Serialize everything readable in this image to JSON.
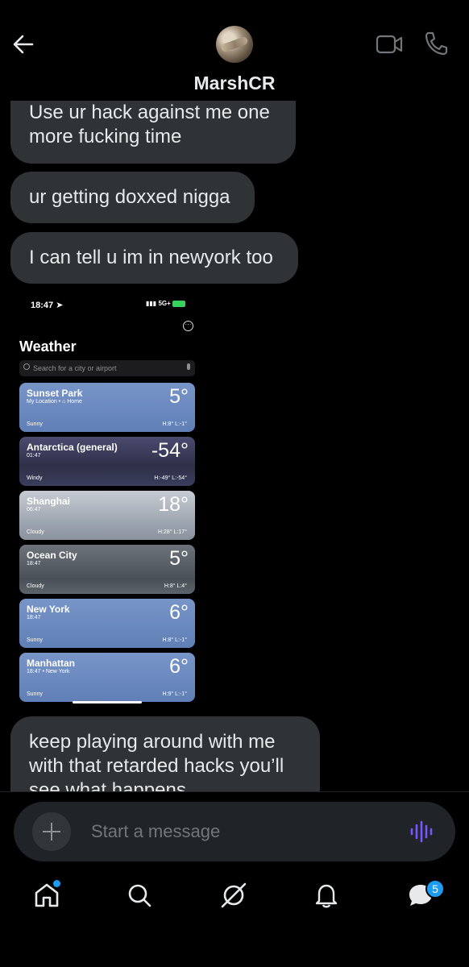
{
  "header": {
    "contact_name": "MarshCR",
    "icons": [
      "back-arrow-icon",
      "video-call-icon",
      "phone-call-icon"
    ]
  },
  "messages": [
    "Use ur hack against me one\nmore fucking time",
    "ur getting doxxed nigga",
    "I can tell u im in newyork too",
    "keep playing around with me\nwith that retarded hacks you’ll\nsee what happens"
  ],
  "attachment": {
    "status_time": "18:47",
    "status_network": "5G+",
    "app_title": "Weather",
    "search_placeholder": "Search for a city or airport",
    "locations": [
      {
        "city": "Sunset Park",
        "sub": "My Location • ⌂ Home",
        "temp": "5°",
        "condition": "Sunny",
        "hilo": "H:8°  L:-1°"
      },
      {
        "city": "Antarctica (general)",
        "sub": "01:47",
        "temp": "-54°",
        "condition": "Windy",
        "hilo": "H:-49°  L:-54°"
      },
      {
        "city": "Shanghai",
        "sub": "06:47",
        "temp": "18°",
        "condition": "Cloudy",
        "hilo": "H:28°  L:17°"
      },
      {
        "city": "Ocean City",
        "sub": "18:47",
        "temp": "5°",
        "condition": "Cloudy",
        "hilo": "H:8°  L:4°"
      },
      {
        "city": "New York",
        "sub": "18:47",
        "temp": "6°",
        "condition": "Sunny",
        "hilo": "H:8°  L:-1°"
      },
      {
        "city": "Manhattan",
        "sub": "18:47 • New York",
        "temp": "6°",
        "condition": "Sunny",
        "hilo": "H:9°  L:-1°"
      }
    ]
  },
  "composer": {
    "placeholder": "Start a message"
  },
  "nav": {
    "items": [
      "home-icon",
      "search-icon",
      "grok-icon",
      "notifications-icon",
      "messages-icon"
    ],
    "messages_badge": "5"
  },
  "colors": {
    "bubble": "#2f3336",
    "accent": "#1d9bf0",
    "voice": "#7856ff"
  }
}
